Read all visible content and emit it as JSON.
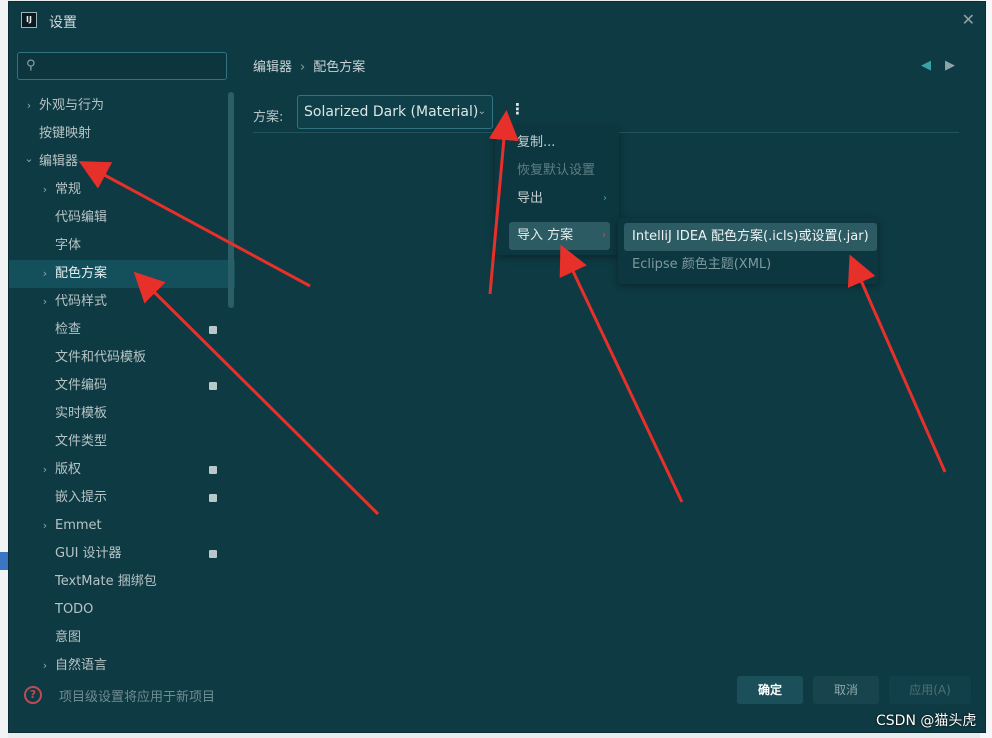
{
  "window": {
    "title": "设置",
    "app_icon_text": "IJ"
  },
  "search": {
    "placeholder": ""
  },
  "sidebar": {
    "items": [
      {
        "label": "外观与行为",
        "expandable": true,
        "expanded": false,
        "level": 0
      },
      {
        "label": "按键映射",
        "expandable": false,
        "level": 0
      },
      {
        "label": "编辑器",
        "expandable": true,
        "expanded": true,
        "level": 0
      },
      {
        "label": "常规",
        "expandable": true,
        "expanded": false,
        "level": 1
      },
      {
        "label": "代码编辑",
        "expandable": false,
        "level": 1
      },
      {
        "label": "字体",
        "expandable": false,
        "level": 1
      },
      {
        "label": "配色方案",
        "expandable": true,
        "expanded": false,
        "level": 1,
        "selected": true
      },
      {
        "label": "代码样式",
        "expandable": true,
        "expanded": false,
        "level": 1
      },
      {
        "label": "检查",
        "expandable": false,
        "level": 1,
        "badge": true
      },
      {
        "label": "文件和代码模板",
        "expandable": false,
        "level": 1
      },
      {
        "label": "文件编码",
        "expandable": false,
        "level": 1,
        "badge": true
      },
      {
        "label": "实时模板",
        "expandable": false,
        "level": 1
      },
      {
        "label": "文件类型",
        "expandable": false,
        "level": 1
      },
      {
        "label": "版权",
        "expandable": true,
        "expanded": false,
        "level": 1,
        "badge": true
      },
      {
        "label": "嵌入提示",
        "expandable": false,
        "level": 1,
        "badge": true
      },
      {
        "label": "Emmet",
        "expandable": true,
        "expanded": false,
        "level": 1
      },
      {
        "label": "GUI 设计器",
        "expandable": false,
        "level": 1,
        "badge": true
      },
      {
        "label": "TextMate 捆绑包",
        "expandable": false,
        "level": 1
      },
      {
        "label": "TODO",
        "expandable": false,
        "level": 1
      },
      {
        "label": "意图",
        "expandable": false,
        "level": 1
      },
      {
        "label": "自然语言",
        "expandable": true,
        "expanded": false,
        "level": 1
      }
    ]
  },
  "breadcrumb": {
    "parent": "编辑器",
    "separator": "›",
    "current": "配色方案"
  },
  "scheme": {
    "label": "方案:",
    "value": "Solarized Dark (Material)"
  },
  "context_menu": {
    "items": [
      {
        "label": "复制...",
        "disabled": false
      },
      {
        "label": "恢复默认设置",
        "disabled": true
      },
      {
        "label": "导出",
        "has_submenu": true
      },
      {
        "label": "导入 方案",
        "has_submenu": true,
        "highlighted": true
      }
    ]
  },
  "import_submenu": {
    "items": [
      {
        "label": "IntelliJ IDEA 配色方案(.icls)或设置(.jar)",
        "highlighted": true
      },
      {
        "label": "Eclipse 颜色主题(XML)",
        "highlighted": false
      }
    ]
  },
  "footer": {
    "help_text": "?",
    "note": "项目级设置将应用于新项目",
    "ok": "确定",
    "cancel": "取消",
    "apply": "应用(A)"
  },
  "watermark": "CSDN @猫头虎",
  "colors": {
    "background": "#0e3a43",
    "selected": "#13505b",
    "accent": "#3aa3a8",
    "annotation_arrow": "#e8302a"
  }
}
